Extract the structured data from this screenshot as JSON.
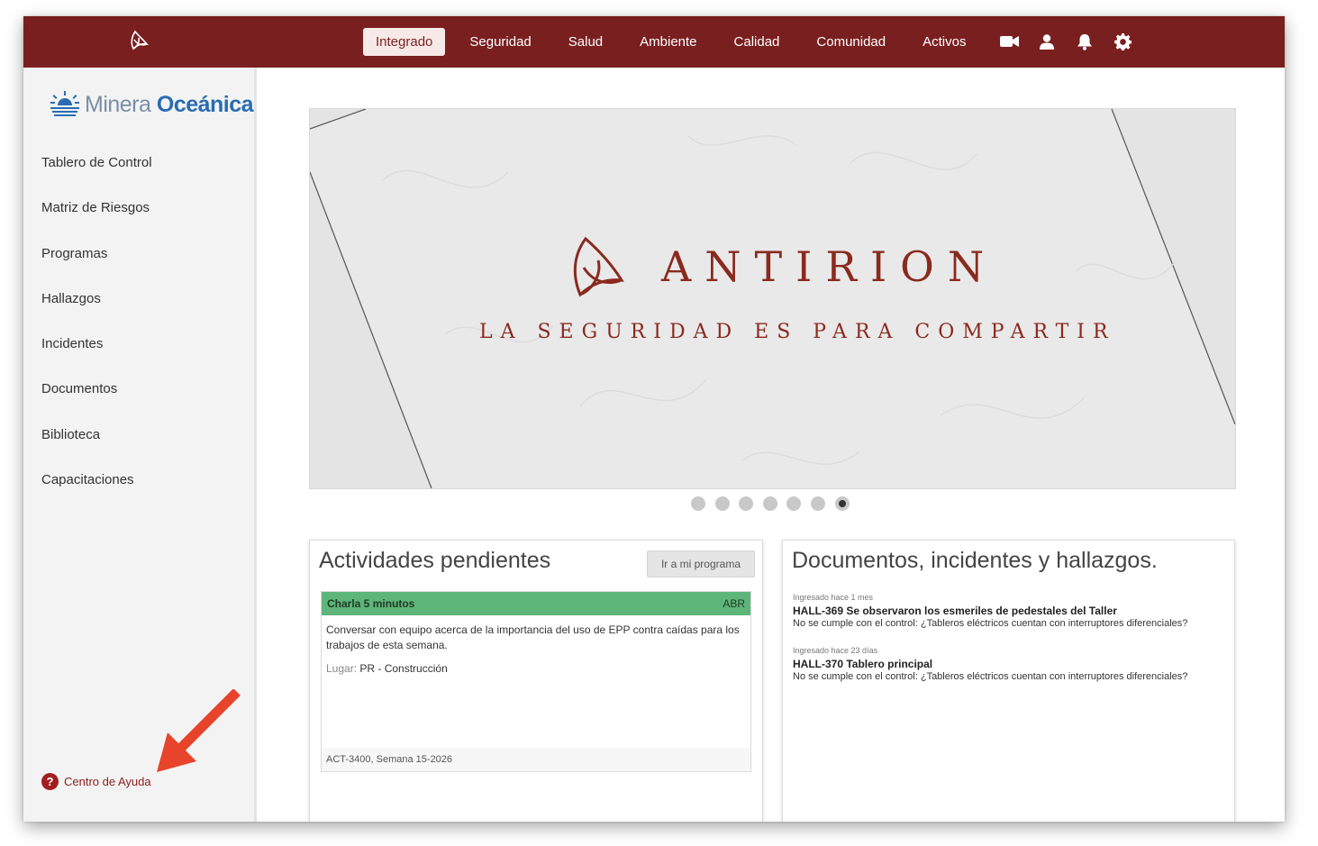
{
  "topbar": {
    "nav": [
      {
        "label": "Integrado",
        "active": true
      },
      {
        "label": "Seguridad"
      },
      {
        "label": "Salud"
      },
      {
        "label": "Ambiente"
      },
      {
        "label": "Calidad"
      },
      {
        "label": "Comunidad"
      },
      {
        "label": "Activos"
      }
    ],
    "icons": [
      "video-camera-icon",
      "user-icon",
      "bell-icon",
      "gear-icon"
    ]
  },
  "sidebar": {
    "brand": {
      "light": "Minera",
      "bold": "Oceánica"
    },
    "items": [
      {
        "label": "Tablero de Control"
      },
      {
        "label": "Matriz de Riesgos"
      },
      {
        "label": "Programas"
      },
      {
        "label": "Hallazgos"
      },
      {
        "label": "Incidentes"
      },
      {
        "label": "Documentos"
      },
      {
        "label": "Biblioteca"
      },
      {
        "label": "Capacitaciones"
      }
    ],
    "help": {
      "icon": "?",
      "label": "Centro de Ayuda"
    }
  },
  "banner": {
    "title": "ANTIRION",
    "subtitle": "LA SEGURIDAD ES PARA COMPARTIR",
    "slide_count": 7,
    "active_slide": 7
  },
  "pending": {
    "title": "Actividades pendientes",
    "button": "Ir a mi programa",
    "activity": {
      "name": "Charla 5 minutos",
      "month": "ABR",
      "description": "Conversar con equipo acerca de la importancia del uso de EPP contra caídas para los trabajos de esta semana.",
      "place_label": "Lugar:",
      "place": "PR - Construcción",
      "footer": "ACT-3400, Semana 15-2026"
    }
  },
  "documents": {
    "title": "Documentos, incidentes y hallazgos.",
    "items": [
      {
        "meta": "Ingresado hace 1 mes",
        "title": "HALL-369 Se observaron los esmeriles de pedestales del Taller",
        "desc": "No se cumple con el control: ¿Tableros eléctricos cuentan con interruptores diferenciales?"
      },
      {
        "meta": "Ingresado hace 23 días",
        "title": "HALL-370 Tablero principal",
        "desc": "No se cumple con el control: ¿Tableros eléctricos cuentan con interruptores diferenciales?"
      }
    ]
  },
  "colors": {
    "topbar": "#7a1f1f",
    "brand_blue": "#2a6cb2",
    "activity_green": "#5db57a",
    "arrow_red": "#e8432b",
    "antirion_red": "#8a2a1e"
  }
}
